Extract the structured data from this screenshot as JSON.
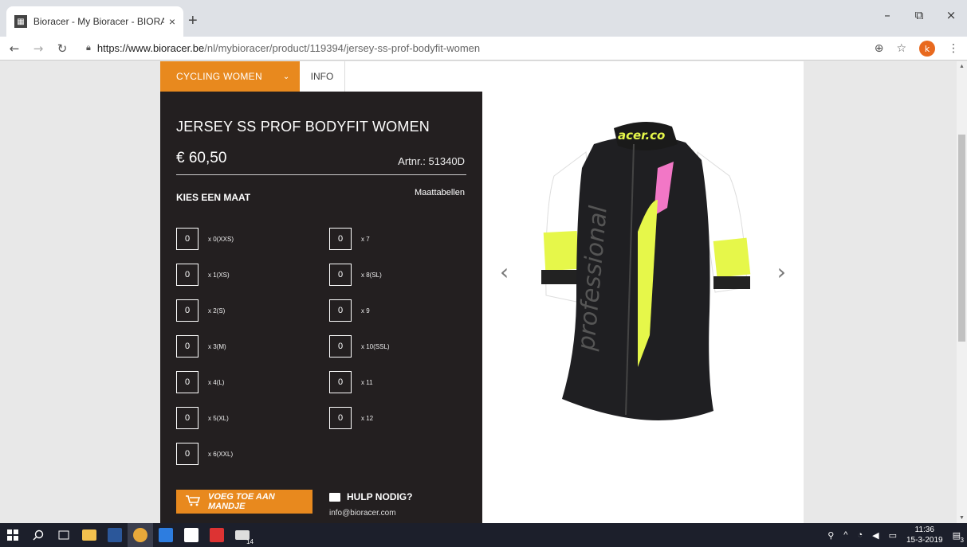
{
  "browser": {
    "tab_title": "Bioracer - My Bioracer - BIORACE",
    "tab_close": "×",
    "new_tab": "+",
    "url_host": "https://www.bioracer.be",
    "url_path": "/nl/mybioracer/product/119394/jersey-ss-prof-bodyfit-women",
    "profile_initial": "k",
    "win_min": "–",
    "win_max": "⧉",
    "win_close": "×"
  },
  "nav": {
    "category": "CYCLING WOMEN",
    "info": "INFO"
  },
  "product": {
    "title": "JERSEY SS PROF BODYFIT WOMEN",
    "price": "€ 60,50",
    "artnr": "Artnr.: 51340D",
    "choose_size": "KIES EEN MAAT",
    "size_tables": "Maattabellen",
    "sizes_left": [
      {
        "value": "0",
        "label": "x 0(XXS)"
      },
      {
        "value": "0",
        "label": "x 1(XS)"
      },
      {
        "value": "0",
        "label": "x 2(S)"
      },
      {
        "value": "0",
        "label": "x 3(M)"
      },
      {
        "value": "0",
        "label": "x 4(L)"
      },
      {
        "value": "0",
        "label": "x 5(XL)"
      },
      {
        "value": "0",
        "label": "x 6(XXL)"
      }
    ],
    "sizes_right": [
      {
        "value": "0",
        "label": "x 7"
      },
      {
        "value": "0",
        "label": "x 8(SL)"
      },
      {
        "value": "0",
        "label": "x 9"
      },
      {
        "value": "0",
        "label": "x 10(SSL)"
      },
      {
        "value": "0",
        "label": "x 11"
      },
      {
        "value": "0",
        "label": "x 12"
      }
    ],
    "add_to_cart": "VOEG TOE AAN MANDJE",
    "help_title": "HULP NODIG?",
    "help_email": "info@bioracer.com",
    "jersey_collar_text": "acer.co",
    "jersey_text": "professional"
  },
  "taskbar": {
    "time": "11:36",
    "date": "15-3-2019",
    "badge": "14",
    "notif": "3"
  },
  "colors": {
    "accent": "#e8891e",
    "panel": "#231f20",
    "jersey_yellow": "#e6f74a",
    "jersey_pink": "#f277c6"
  }
}
